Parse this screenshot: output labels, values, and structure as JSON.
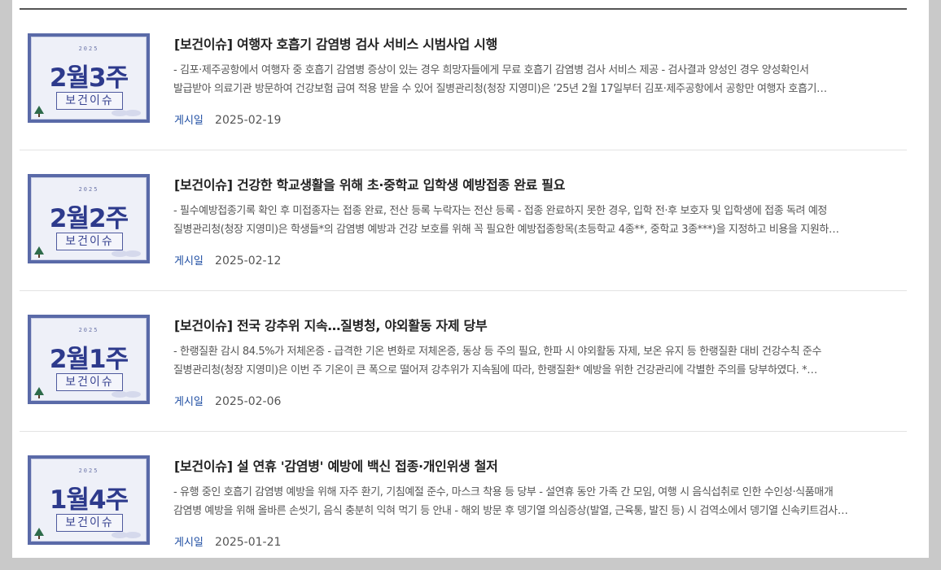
{
  "colors": {
    "background": "#c9c9c9",
    "panel": "#ffffff",
    "title": "#222222",
    "text": "#555555",
    "meta_label": "#1f4ea3",
    "thumb_frame": "#5a6aa8",
    "thumb_accent": "#2d3a8c"
  },
  "posts": [
    {
      "thumb": {
        "year": "2025",
        "week": "2월3주",
        "tag": "보건이슈"
      },
      "title": "[보건이슈] 여행자 호흡기 감염병 검사 서비스 시범사업 시행",
      "summary_line1": " - 김포·제주공항에서 여행자 중 호흡기 감염병 증상이 있는 경우 희망자들에게 무료 호흡기 감염병 검사 서비스 제공 - 검사결과 양성인 경우 양성확인서",
      "summary_line2": "발급받아 의료기관 방문하여 건강보험 급여 적용 받을 수 있어   질병관리청(청장 지영미)은 ’25년 2월 17일부터 김포·제주공항에서 공항만 여행자 호흡기…",
      "date_label": "게시일",
      "date": "2025-02-19"
    },
    {
      "thumb": {
        "year": "2025",
        "week": "2월2주",
        "tag": "보건이슈"
      },
      "title": "[보건이슈] 건강한 학교생활을 위해 초·중학교 입학생 예방접종 완료 필요",
      "summary_line1": "- 필수예방접종기록 확인 후 미접종자는 접종 완료, 전산 등록 누락자는 전산 등록 - 접종 완료하지 못한 경우, 입학 전·후 보호자 및 입학생에 접종 독려 예정",
      "summary_line2": "질병관리청(청장 지영미)은 학생들*의 감염병 예방과 건강 보호를 위해 꼭 필요한 예방접종항목(초등학교 4종**, 중학교 3종***)을 지정하고 비용을 지원하…",
      "date_label": "게시일",
      "date": "2025-02-12"
    },
    {
      "thumb": {
        "year": "2025",
        "week": "2월1주",
        "tag": "보건이슈"
      },
      "title": "[보건이슈] 전국 강추위 지속…질병청, 야외활동 자제 당부",
      "summary_line1": " - 한랭질환 감시 84.5%가 저체온증 - 급격한 기온 변화로 저체온증, 동상 등 주의 필요, 한파 시 야외활동 자제, 보온 유지 등 한랭질환 대비 건강수칙 준수",
      "summary_line2": "질병관리청(청장 지영미)은 이번 주 기온이 큰 폭으로 떨어져 강추위가 지속됨에 따라, 한랭질환* 예방을 위한 건강관리에 각별한 주의를 당부하였다.   *…",
      "date_label": "게시일",
      "date": "2025-02-06"
    },
    {
      "thumb": {
        "year": "2025",
        "week": "1월4주",
        "tag": "보건이슈"
      },
      "title": "[보건이슈] 설 연휴 '감염병' 예방에 백신 접종·개인위생 철저",
      "summary_line1": " - 유행 중인 호흡기 감염병 예방을 위해 자주 환기, 기침예절 준수, 마스크 착용 등 당부 - 설연휴 동안 가족 간 모임, 여행 시 음식섭취로 인한 수인성·식품매개",
      "summary_line2": "감염병 예방을 위해 올바른 손씻기, 음식 충분히 익혀 먹기 등 안내 - 해외 방문 후 뎅기열 의심증상(발열, 근육통, 발진 등) 시 검역소에서 뎅기열 신속키트검사…",
      "date_label": "게시일",
      "date": "2025-01-21"
    }
  ]
}
